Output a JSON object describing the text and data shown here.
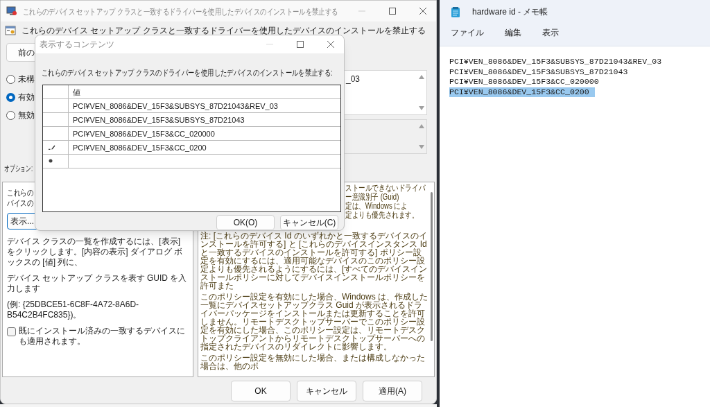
{
  "main_window": {
    "title": "これらのデバイス セットアップ クラスと一致するドライバーを使用したデバイスのインストールを禁止する",
    "header": "これらのデバイス セットアップ クラスと一致するドライバーを使用したデバイスのインストールを禁止する",
    "prev_button": "前の",
    "radios": [
      {
        "label": "未構",
        "selected": false
      },
      {
        "label": "有効",
        "selected": true
      },
      {
        "label": "無効",
        "selected": false
      }
    ],
    "comment_fragment": "_03",
    "options_label": "オプション:",
    "options": {
      "intro_lines": [
        "これらの",
        "バイスの"
      ],
      "show_button": "表示...",
      "paragraphs": [
        "デバイス クラスの一覧を作成するには、[表示] をクリックします。[内容の表示] ダイアログ ボックスの [値] 列に、",
        "デバイス セットアップ クラスを表す GUID を入力します",
        "(例: {25DBCE51-6C8F-4A72-8A6D-B54C2B4FC835})。"
      ],
      "checkbox": {
        "label": "既にインストール済みの一致するデバイスにも適用されます。",
        "checked": false
      }
    },
    "help": {
      "fragment_lines": [
        "ストールできないドライバ",
        "ー意識別子 (Guid)",
        "定は、Windows によ",
        "定よりも優先されます。"
      ],
      "paragraphs": [
        "注: [これらのデバイス Id のいずれかと一致するデバイスのインストールを許可する] と [これらのデバイスインスタンス Id と一致するデバイスのインストールを許可する] ポリシー設定を有効にするには、適用可能なデバイスのこのポリシー設定よりも優先されるようにするには、[すべてのデバイスインストールポリシーに対してデバイスインストールポリシーを許可また",
        "このポリシー設定を有効にした場合、Windows は、作成した一覧にデバイスセットアップクラス Guid が表示されるドライバーパッケージをインストールまたは更新することを許可しません。リモートデスクトップサーバーでこのポリシー設定を有効にした場合、このポリシー設定は、リモートデスクトップクライアントからリモートデスクトップサーバーへの指定されたデバイスのリダイレクトに影響します。",
        "このポリシー設定を無効にした場合、または構成しなかった場合は、他のポ"
      ]
    },
    "buttons": [
      "OK",
      "キャンセル",
      "適用(A)"
    ]
  },
  "dialog": {
    "title": "表示するコンテンツ",
    "prompt": "これらのデバイス セットアップ クラスのドライバーを使用したデバイスのインストールを禁止する:",
    "column": "値",
    "rows": [
      {
        "kind": "value",
        "value": "PCI¥VEN_8086&DEV_15F3&SUBSYS_87D21043&REV_03",
        "editing": false
      },
      {
        "kind": "value",
        "value": "PCI¥VEN_8086&DEV_15F3&SUBSYS_87D21043",
        "editing": false
      },
      {
        "kind": "value",
        "value": "PCI¥VEN_8086&DEV_15F3&CC_020000",
        "editing": false
      },
      {
        "kind": "value",
        "value": "PCI¥VEN_8086&DEV_15F3&CC_0200",
        "editing": true
      },
      {
        "kind": "new"
      }
    ],
    "buttons": [
      "OK(O)",
      "キャンセル(C)"
    ]
  },
  "notepad": {
    "title": "hardware id - メモ帳",
    "menu": [
      "ファイル",
      "編集",
      "表示"
    ],
    "lines": [
      {
        "text": "PCI¥VEN_8086&DEV_15F3&SUBSYS_87D21043&REV_03",
        "selected": false
      },
      {
        "text": "PCI¥VEN_8086&DEV_15F3&SUBSYS_87D21043",
        "selected": false
      },
      {
        "text": "PCI¥VEN_8086&DEV_15F3&CC_020000",
        "selected": false
      },
      {
        "text": "PCI¥VEN_8086&DEV_15F3&CC_0200",
        "selected": true
      }
    ]
  }
}
